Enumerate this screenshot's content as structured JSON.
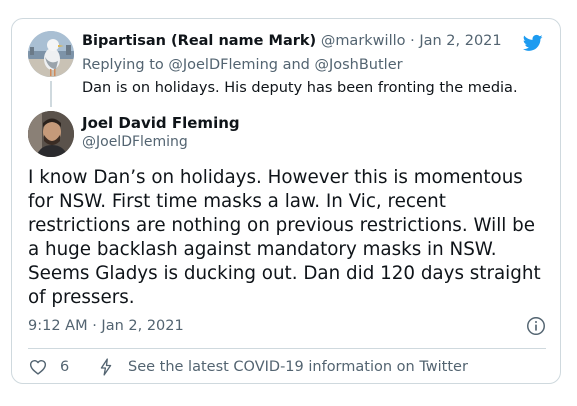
{
  "colors": {
    "brand": "#1d9bf0",
    "text": "#0f1419",
    "muted": "#536471",
    "border": "#cfd9de"
  },
  "parent": {
    "display_name": "Bipartisan (Real name Mark)",
    "handle": "@markwillo",
    "separator": " · ",
    "date": "Jan 2, 2021",
    "replying_prefix": "Replying to",
    "reply_mentions": [
      "@JoelDFleming",
      "@JoshButler"
    ],
    "reply_joiner": "and",
    "text": "Dan is on holidays. His deputy has been fronting the media.",
    "avatar_icon": "seagull-avatar"
  },
  "tweet": {
    "display_name": "Joel David Fleming",
    "handle": "@JoelDFleming",
    "avatar_icon": "user-photo-avatar",
    "lines": [
      "I know Dan’s on holidays. However this is momentous",
      "for NSW. First time masks a law. In Vic, recent",
      "restrictions are nothing on previous restrictions. Will be",
      "a huge backlash against mandatory masks in NSW.",
      "Seems Gladys is ducking out. Dan did 120 days straight",
      "of pressers."
    ],
    "timestamp": "9:12 AM · Jan 2, 2021"
  },
  "actions": {
    "like_count": "6",
    "covid_link": "See the latest COVID-19 information on Twitter"
  },
  "icons": [
    "twitter-bird-icon",
    "info-icon",
    "heart-icon",
    "lightning-icon"
  ]
}
